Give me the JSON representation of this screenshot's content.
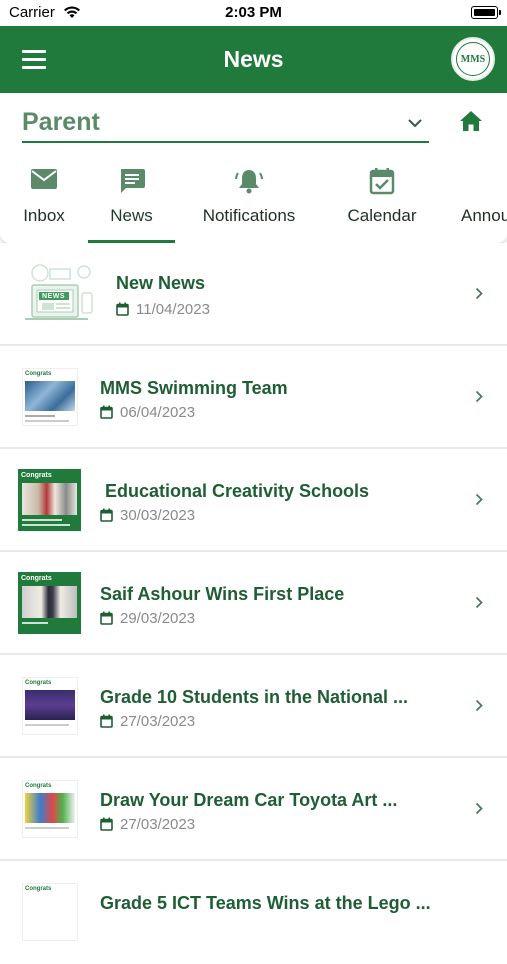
{
  "status": {
    "carrier": "Carrier",
    "time": "2:03 PM"
  },
  "header": {
    "title": "News",
    "logo_text": "MMS"
  },
  "role_select": {
    "value": "Parent"
  },
  "tabs": [
    {
      "label": "Inbox",
      "icon": "mail-icon"
    },
    {
      "label": "News",
      "icon": "chat-icon",
      "active": true
    },
    {
      "label": "Notifications",
      "icon": "bell-icon"
    },
    {
      "label": "Calendar",
      "icon": "calendar-check-icon"
    },
    {
      "label": "Annou"
    }
  ],
  "news": [
    {
      "title": "New News",
      "date": "11/04/2023"
    },
    {
      "title": "MMS Swimming Team",
      "date": "06/04/2023"
    },
    {
      "title": "Educational Creativity Schools",
      "date": "30/03/2023"
    },
    {
      "title": "Saif Ashour Wins First Place",
      "date": "29/03/2023"
    },
    {
      "title": "Grade 10 Students in the National ...",
      "date": "27/03/2023"
    },
    {
      "title": "Draw Your Dream Car Toyota Art ...",
      "date": "27/03/2023"
    },
    {
      "title": "Grade 5 ICT Teams Wins at the Lego ...",
      "date": ""
    }
  ],
  "thumbs": {
    "news_badge": "NEWS",
    "congrats": "Congrats"
  },
  "colors": {
    "primary": "#1f7a3c",
    "title_green": "#1f5e35",
    "date_gray": "#8a8a8a"
  }
}
